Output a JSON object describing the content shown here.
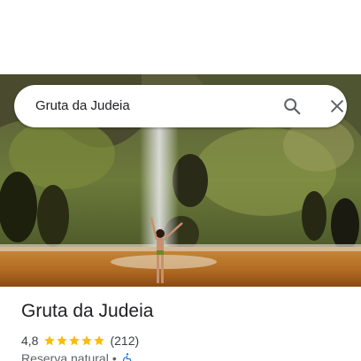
{
  "search": {
    "value": "Gruta da Judeia"
  },
  "place": {
    "title": "Gruta da Judeia",
    "rating": "4,8",
    "rating_value": 4.8,
    "stars_max": 5,
    "review_count": "(212)",
    "category": "Reserva natural",
    "separator": "•"
  },
  "colors": {
    "star": "#fbbc04",
    "accessibility_icon": "#1a73e8",
    "icon_gray": "#5f6368"
  },
  "icons": {
    "search": "search-icon",
    "close": "close-icon",
    "accessibility": "wheelchair-icon"
  }
}
